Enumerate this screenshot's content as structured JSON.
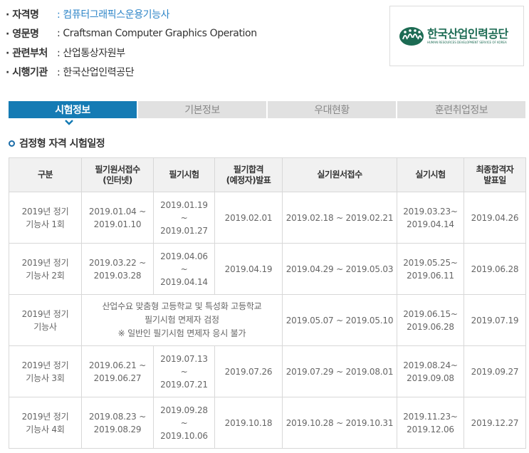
{
  "info": [
    {
      "label": "· 자격명",
      "value": ": 컴퓨터그래픽스운용기능사",
      "highlight": true
    },
    {
      "label": "· 영문명",
      "value": ": Craftsman Computer Graphics Operation",
      "highlight": false
    },
    {
      "label": "· 관련부처",
      "value": ": 산업통상자원부",
      "highlight": false
    },
    {
      "label": "· 시행기관",
      "value": ": 한국산업인력공단",
      "highlight": false
    }
  ],
  "logo": {
    "name_ko": "한국산업인력공단",
    "name_en": "HUMAN RESOURCES DEVELOPMENT SERVICE OF KOREA",
    "color": "#1c6b53"
  },
  "tabs": [
    {
      "label": "시험정보",
      "active": true
    },
    {
      "label": "기본정보",
      "active": false
    },
    {
      "label": "우대현황",
      "active": false
    },
    {
      "label": "훈련취업정보",
      "active": false
    }
  ],
  "accent_color": "#157bb4",
  "section_title": "검정형 자격 시험일정",
  "table": {
    "headers": [
      [
        "구분"
      ],
      [
        "필기원서접수",
        "(인터넷)"
      ],
      [
        "필기시험"
      ],
      [
        "필기합격",
        "(예정자)발표"
      ],
      [
        "실기원서접수"
      ],
      [
        "실기시험"
      ],
      [
        "최종합격자",
        "발표일"
      ]
    ],
    "rows": [
      {
        "type": [
          "2019년 정기",
          "기능사 1회"
        ],
        "written_apply": [
          "2019.01.04 ~",
          "2019.01.10"
        ],
        "written_exam": [
          "2019.01.19",
          "~",
          "2019.01.27"
        ],
        "written_result": [
          "2019.02.01"
        ],
        "practical_apply": [
          "2019.02.18 ~ 2019.02.21"
        ],
        "practical_exam": [
          "2019.03.23~",
          "2019.04.14"
        ],
        "final_result": [
          "2019.04.26"
        ]
      },
      {
        "type": [
          "2019년 정기",
          "기능사 2회"
        ],
        "written_apply": [
          "2019.03.22 ~",
          "2019.03.28"
        ],
        "written_exam": [
          "2019.04.06",
          "~",
          "2019.04.14"
        ],
        "written_result": [
          "2019.04.19"
        ],
        "practical_apply": [
          "2019.04.29 ~ 2019.05.03"
        ],
        "practical_exam": [
          "2019.05.25~",
          "2019.06.11"
        ],
        "final_result": [
          "2019.06.28"
        ]
      },
      {
        "type": [
          "2019년 정기",
          "기능사"
        ],
        "merged_note": [
          "산업수요 맞춤형 고등학교 및 특성화 고등학교",
          "필기시험 면제자 검정",
          "※ 일반인 필기시험 면제자 응시 불가"
        ],
        "practical_apply": [
          "2019.05.07 ~ 2019.05.10"
        ],
        "practical_exam": [
          "2019.06.15~",
          "2019.06.28"
        ],
        "final_result": [
          "2019.07.19"
        ]
      },
      {
        "type": [
          "2019년 정기",
          "기능사 3회"
        ],
        "written_apply": [
          "2019.06.21 ~",
          "2019.06.27"
        ],
        "written_exam": [
          "2019.07.13",
          "~",
          "2019.07.21"
        ],
        "written_result": [
          "2019.07.26"
        ],
        "practical_apply": [
          "2019.07.29 ~ 2019.08.01"
        ],
        "practical_exam": [
          "2019.08.24~",
          "2019.09.08"
        ],
        "final_result": [
          "2019.09.27"
        ]
      },
      {
        "type": [
          "2019년 정기",
          "기능사 4회"
        ],
        "written_apply": [
          "2019.08.23 ~",
          "2019.08.29"
        ],
        "written_exam": [
          "2019.09.28",
          "~",
          "2019.10.06"
        ],
        "written_result": [
          "2019.10.18"
        ],
        "practical_apply": [
          "2019.10.28 ~ 2019.10.31"
        ],
        "practical_exam": [
          "2019.11.23~",
          "2019.12.06"
        ],
        "final_result": [
          "2019.12.27"
        ]
      }
    ]
  }
}
